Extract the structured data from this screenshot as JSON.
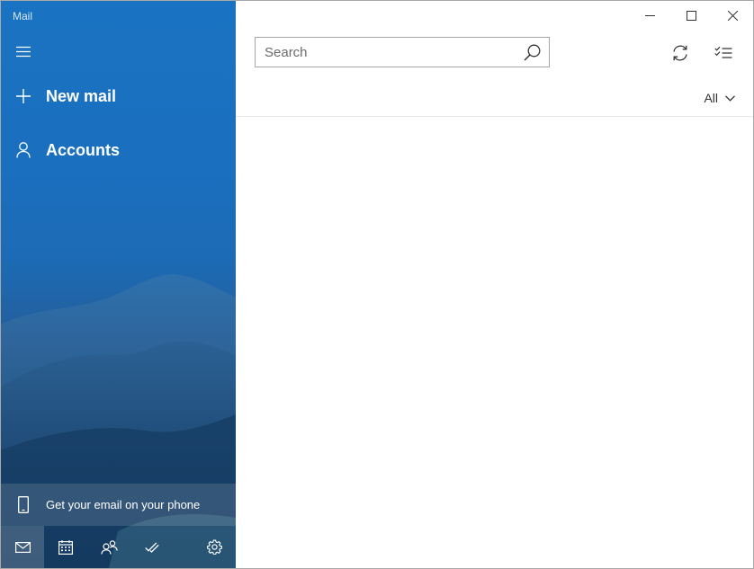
{
  "app": {
    "title": "Mail"
  },
  "sidebar": {
    "menu_icon": "hamburger-icon",
    "new_mail": {
      "label": "New mail",
      "icon": "plus-icon"
    },
    "accounts": {
      "label": "Accounts",
      "icon": "person-icon"
    },
    "promo": {
      "label": "Get your email on your phone",
      "icon": "phone-icon"
    },
    "bottom_bar": [
      {
        "name": "mail",
        "icon": "mail-icon",
        "active": true
      },
      {
        "name": "calendar",
        "icon": "calendar-icon",
        "active": false
      },
      {
        "name": "people",
        "icon": "people-icon",
        "active": false
      },
      {
        "name": "todo",
        "icon": "checkmark-icon",
        "active": false
      },
      {
        "name": "settings",
        "icon": "gear-icon",
        "active": false
      }
    ]
  },
  "window_controls": [
    "minimize-icon",
    "maximize-icon",
    "close-icon"
  ],
  "search": {
    "placeholder": "Search",
    "value": ""
  },
  "toolbar": {
    "sync_icon": "sync-icon",
    "select_icon": "selection-mode-icon"
  },
  "filter": {
    "label": "All"
  },
  "colors": {
    "sidebar_top": "#1a73c2",
    "sidebar_bottom": "#18416b",
    "window_border": "#a9a9a9"
  }
}
